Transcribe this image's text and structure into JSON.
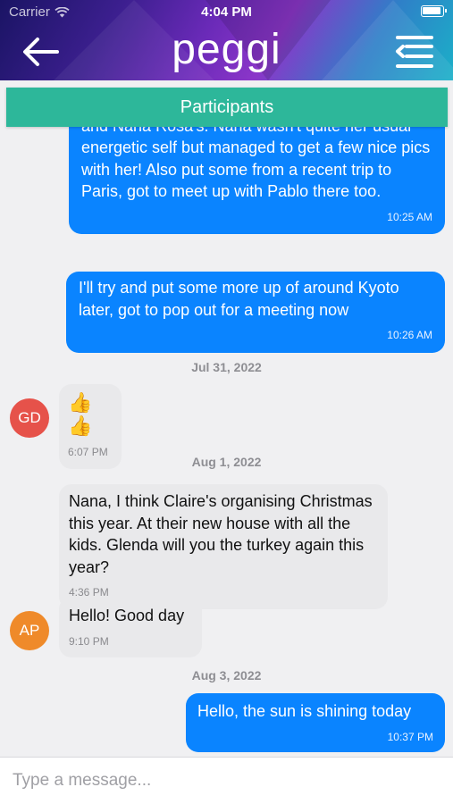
{
  "status_bar": {
    "carrier": "Carrier",
    "time": "4:04 PM"
  },
  "header": {
    "logo": "peggi"
  },
  "participants_label": "Participants",
  "messages": [
    {
      "text": "Just put some pics of a recent trip to Auntie Nell's and Nana Rosa's. Nana wasn't quite her usual energetic self but managed to get a few nice pics with her! Also put some from a recent trip to Paris, got to meet up with Pablo there too.",
      "time": "10:25 AM"
    },
    {
      "text": "I'll try and put some more up of around Kyoto later, got to pop out for a meeting now",
      "time": "10:26 AM"
    },
    {
      "text": "👍👍",
      "time": "6:07 PM"
    },
    {
      "text": "Nana, I think Claire's organising Christmas this year. At their new house with all the kids. Glenda will you the turkey again this year?",
      "time": "4:36 PM"
    },
    {
      "text": "Hello! Good day",
      "time": "9:10 PM"
    },
    {
      "text": "Hello, the sun is shining today",
      "time": "10:37 PM"
    }
  ],
  "dates": [
    "Jul 31, 2022",
    "Aug 1, 2022",
    "Aug 3, 2022"
  ],
  "avatars": [
    {
      "initials": "GD",
      "color": "#e6524a"
    },
    {
      "initials": "AP",
      "color": "#ef8a2a"
    }
  ],
  "composer": {
    "placeholder": "Type a message..."
  },
  "colors": {
    "outgoing_bubble": "#0a84ff",
    "incoming_bubble": "#e9e9eb",
    "participants_bar": "#2db79a"
  },
  "icons": [
    "wifi-icon",
    "battery-icon",
    "back-arrow-icon",
    "menu-icon"
  ]
}
